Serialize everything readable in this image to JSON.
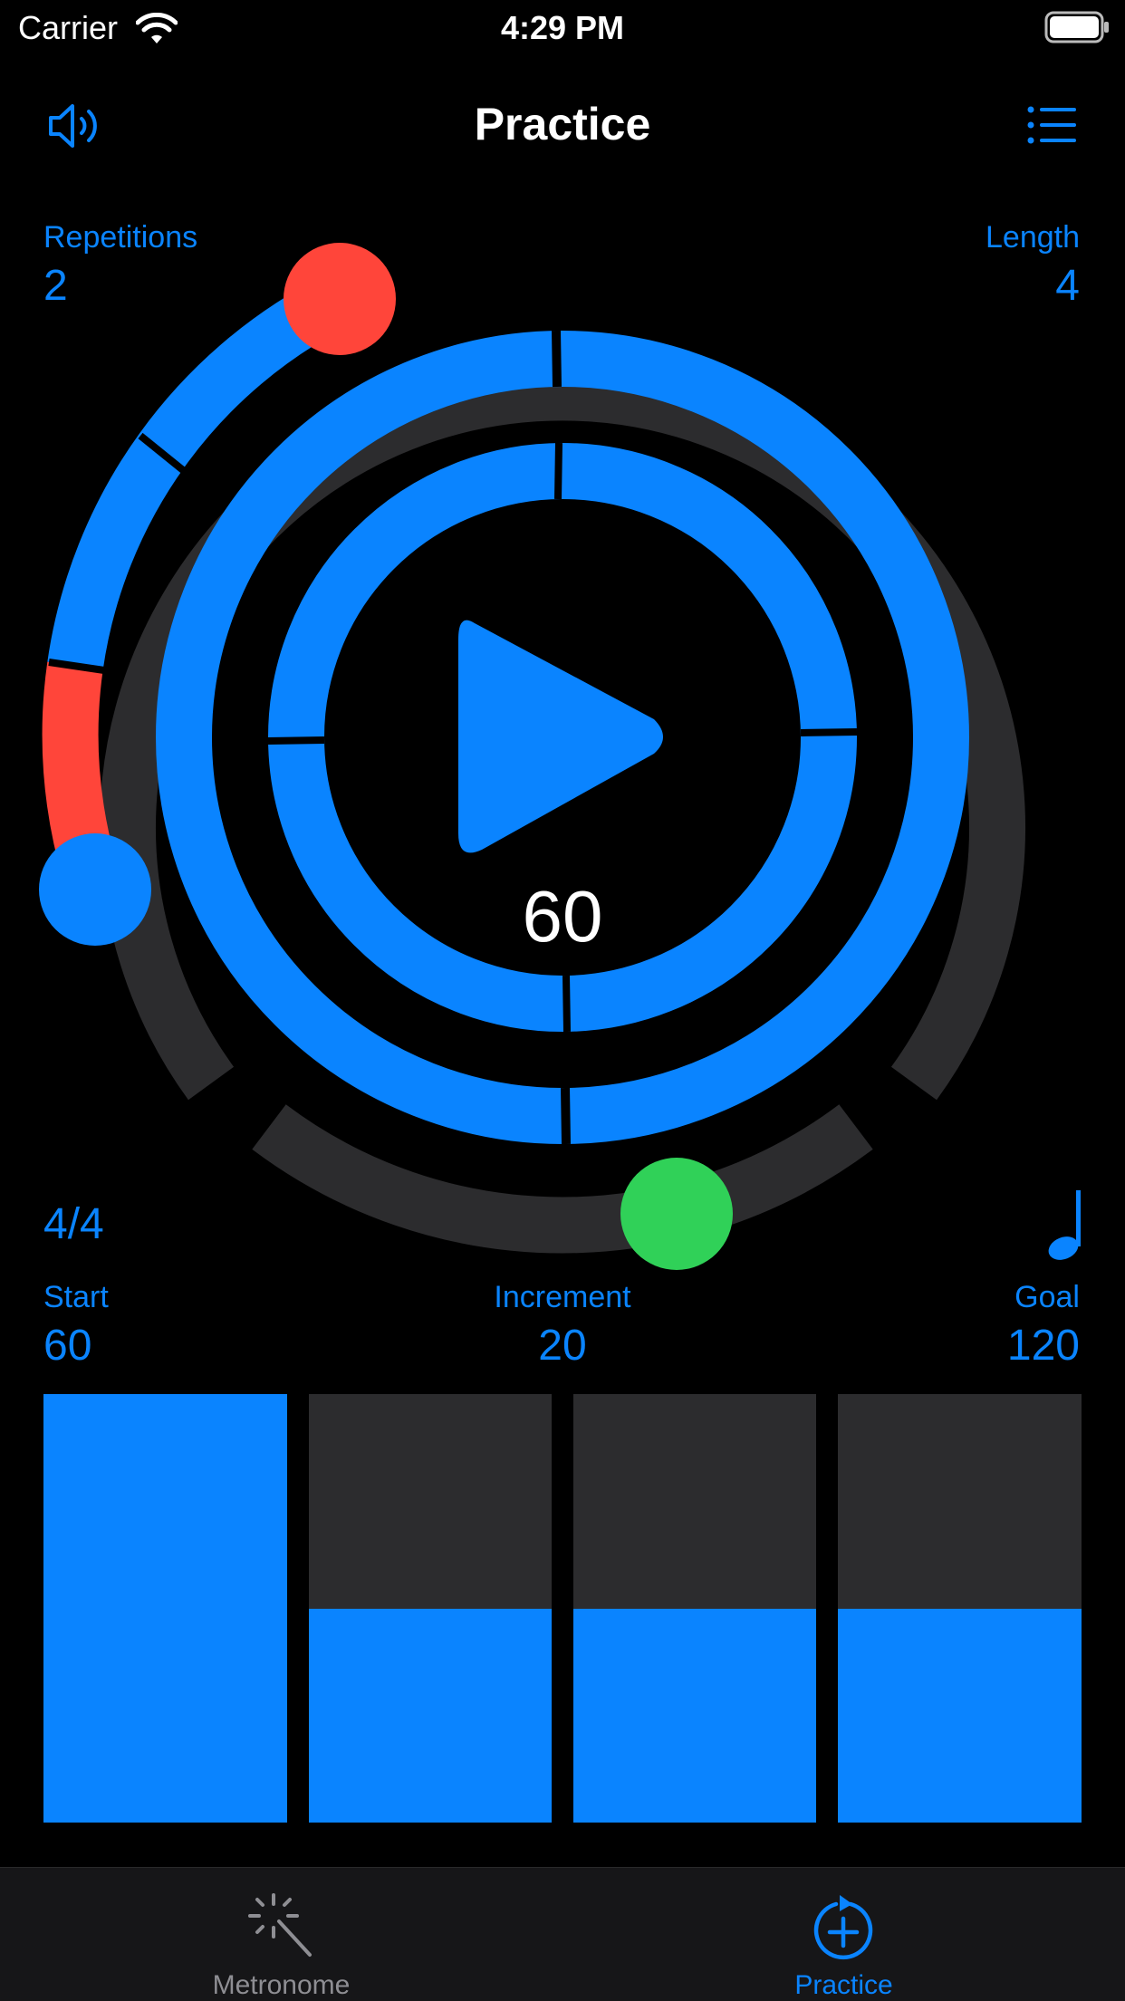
{
  "status_bar": {
    "carrier": "Carrier",
    "time": "4:29 PM"
  },
  "nav": {
    "title": "Practice"
  },
  "repetitions": {
    "label": "Repetitions",
    "value": "2"
  },
  "length": {
    "label": "Length",
    "value": "4"
  },
  "time_signature": "4/4",
  "tempo_bpm": "60",
  "start": {
    "label": "Start",
    "value": "60"
  },
  "increment": {
    "label": "Increment",
    "value": "20"
  },
  "goal": {
    "label": "Goal",
    "value": "120"
  },
  "tempo_bars": [
    {
      "fill_fraction": 1.0
    },
    {
      "fill_fraction": 0.5
    },
    {
      "fill_fraction": 0.5
    },
    {
      "fill_fraction": 0.5
    }
  ],
  "tabs": [
    {
      "label": "Metronome",
      "icon": "magic-wand-icon",
      "selected": false
    },
    {
      "label": "Practice",
      "icon": "add-repeat-icon",
      "selected": true
    }
  ],
  "colors": {
    "accent": "#0a84ff",
    "track": "#2c2c2e",
    "red_knob": "#ff453a",
    "green_knob": "#30d158",
    "inactive_tab": "#8e8e93"
  }
}
